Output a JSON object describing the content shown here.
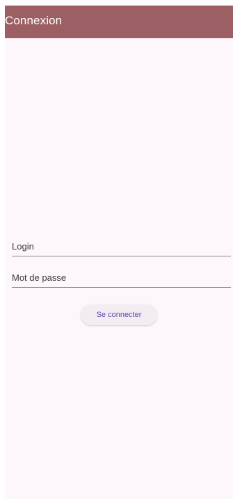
{
  "app_bar": {
    "title": "Connexion"
  },
  "form": {
    "login": {
      "placeholder": "Login",
      "value": ""
    },
    "password": {
      "placeholder": "Mot de passe",
      "value": ""
    },
    "submit_label": "Se connecter"
  },
  "colors": {
    "app_bar": "#9c5f63",
    "background": "#fdf7fb",
    "button_text": "#5a49a7",
    "button_bg": "#f3edf3"
  }
}
